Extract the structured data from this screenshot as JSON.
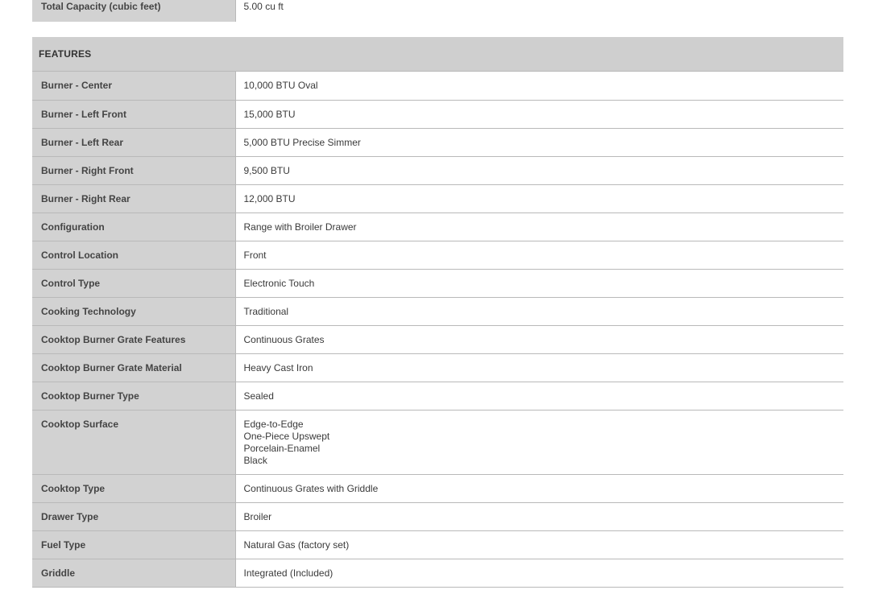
{
  "capacity": {
    "label": "Total Capacity (cubic feet)",
    "value": "5.00 cu ft"
  },
  "features": {
    "header": "FEATURES",
    "rows": [
      {
        "label": "Burner - Center",
        "value": "10,000 BTU Oval"
      },
      {
        "label": "Burner - Left Front",
        "value": "15,000 BTU"
      },
      {
        "label": "Burner - Left Rear",
        "value": "5,000 BTU Precise Simmer"
      },
      {
        "label": "Burner - Right Front",
        "value": "9,500 BTU"
      },
      {
        "label": "Burner - Right Rear",
        "value": "12,000 BTU"
      },
      {
        "label": "Configuration",
        "value": "Range with Broiler Drawer"
      },
      {
        "label": "Control Location",
        "value": "Front"
      },
      {
        "label": "Control Type",
        "value": "Electronic Touch"
      },
      {
        "label": "Cooking Technology",
        "value": "Traditional"
      },
      {
        "label": "Cooktop Burner Grate Features",
        "value": "Continuous Grates"
      },
      {
        "label": "Cooktop Burner Grate Material",
        "value": "Heavy Cast Iron"
      },
      {
        "label": "Cooktop Burner Type",
        "value": "Sealed"
      },
      {
        "label": "Cooktop Surface",
        "values": [
          "Edge-to-Edge",
          "One-Piece Upswept",
          "Porcelain-Enamel",
          "Black"
        ]
      },
      {
        "label": "Cooktop Type",
        "value": "Continuous Grates with Griddle"
      },
      {
        "label": "Drawer Type",
        "value": "Broiler"
      },
      {
        "label": "Fuel Type",
        "value": "Natural Gas (factory set)"
      },
      {
        "label": "Griddle",
        "value": "Integrated (Included)"
      }
    ]
  }
}
